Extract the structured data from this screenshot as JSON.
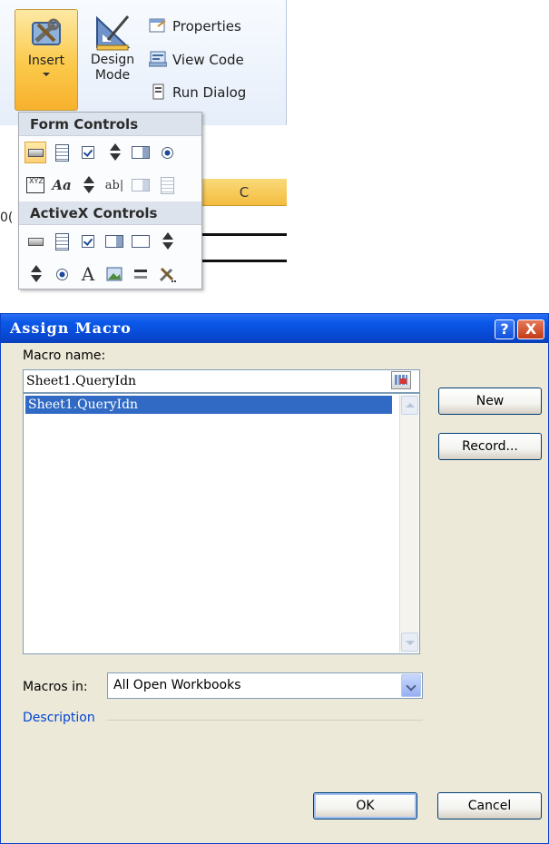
{
  "ribbon": {
    "insert_label": "Insert",
    "design_mode_label_1": "Design",
    "design_mode_label_2": "Mode",
    "properties_label": "Properties",
    "view_code_label": "View Code",
    "run_dialog_label": "Run Dialog",
    "accent_color": "#f7b12d"
  },
  "insert_menu": {
    "form_controls_header": "Form Controls",
    "activex_controls_header": "ActiveX Controls",
    "form_row1_icons": [
      "button-icon",
      "combo-box-icon",
      "check-box-icon",
      "spin-button-icon",
      "list-box-icon",
      "option-button-icon"
    ],
    "form_row2": {
      "group_box_text": "XYZ",
      "label_text": "Aa",
      "text_field_text": "ab|"
    },
    "activex_row2": {
      "label_text": "A"
    }
  },
  "sheet": {
    "column_header": "C",
    "cell_fragment": "0("
  },
  "dialog": {
    "title": "Assign Macro",
    "help_symbol": "?",
    "close_symbol": "X",
    "macro_name_label": "Macro name:",
    "macro_name_value": "Sheet1.QueryIdn",
    "macro_list": [
      "Sheet1.QueryIdn"
    ],
    "new_button": "New",
    "record_button": "Record...",
    "macros_in_label": "Macros in:",
    "macros_in_value": "All Open Workbooks",
    "description_label": "Description",
    "ok_button": "OK",
    "cancel_button": "Cancel",
    "title_bar_color": "#0a58e8",
    "selection_color": "#316ac5"
  }
}
